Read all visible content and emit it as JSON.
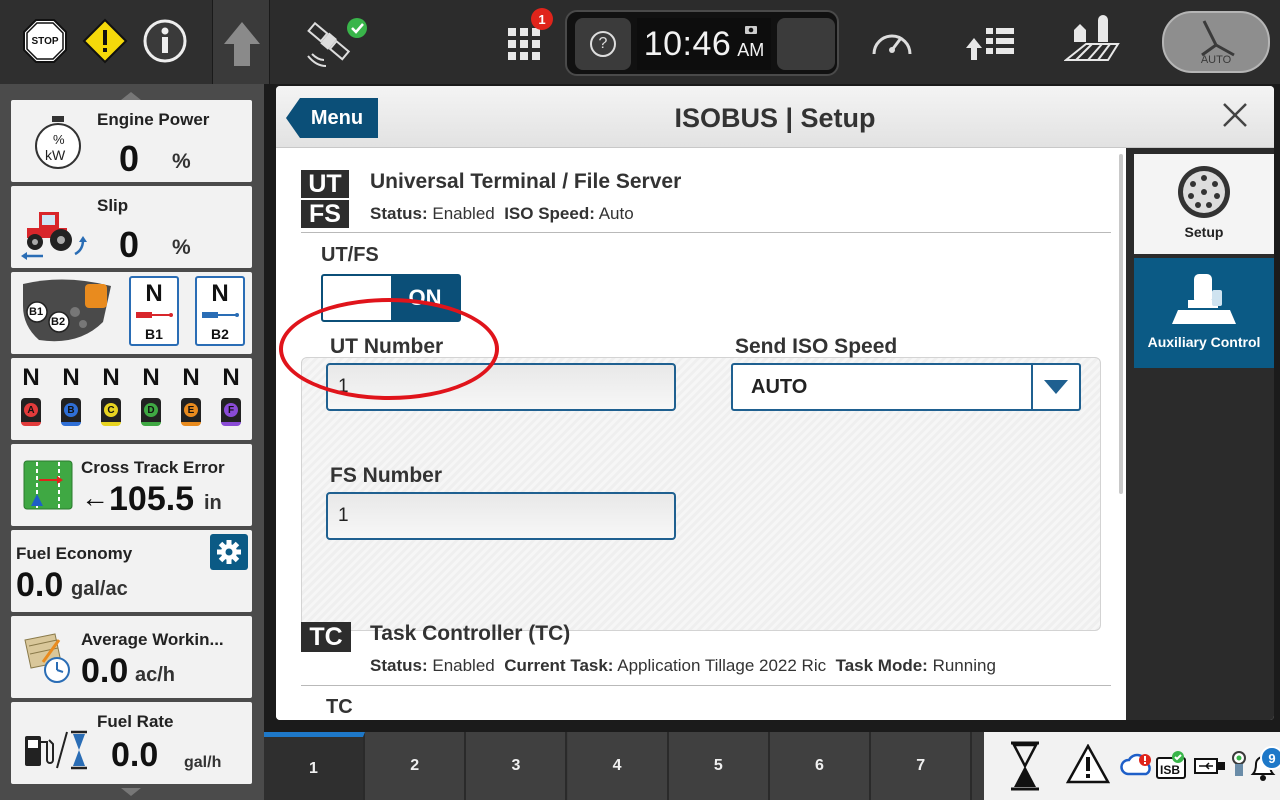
{
  "topbar": {
    "stop_label": "STOP",
    "notification_count": "1",
    "clock_time": "10:46",
    "clock_ampm": "AM",
    "help_label": "?",
    "auto_label": "AUTO"
  },
  "sidebar": {
    "engine_power": {
      "title": "Engine Power",
      "icon_text_top": "%",
      "icon_text_bottom": "kW",
      "value": "0",
      "unit": "%"
    },
    "slip": {
      "title": "Slip",
      "value": "0",
      "unit": "%"
    },
    "remotes": {
      "b1": {
        "state": "N",
        "label": "B1"
      },
      "b2": {
        "state": "N",
        "label": "B2"
      },
      "chip_b1": "B1",
      "chip_b2": "B2"
    },
    "scvs": [
      {
        "state": "N",
        "label": "A",
        "color": "#e23b3b"
      },
      {
        "state": "N",
        "label": "B",
        "color": "#2f6fd6"
      },
      {
        "state": "N",
        "label": "C",
        "color": "#e8d421"
      },
      {
        "state": "N",
        "label": "D",
        "color": "#3fa843"
      },
      {
        "state": "N",
        "label": "E",
        "color": "#e98b1e"
      },
      {
        "state": "N",
        "label": "F",
        "color": "#8a4bd6"
      }
    ],
    "cross_track": {
      "title": "Cross Track Error",
      "arrow": "←",
      "value": "105.5",
      "unit": "in"
    },
    "fuel_economy": {
      "title": "Fuel Economy",
      "value": "0.0",
      "unit": "gal/ac"
    },
    "avg_working": {
      "title": "Average Workin...",
      "value": "0.0",
      "unit": "ac/h"
    },
    "fuel_rate": {
      "title": "Fuel Rate",
      "value": "0.0",
      "unit": "gal/h"
    }
  },
  "panel": {
    "menu_label": "Menu",
    "title": "ISOBUS | Setup",
    "ut_fs": {
      "badge_top": "UT",
      "badge_bottom": "FS",
      "title": "Universal Terminal / File Server",
      "status_label": "Status:",
      "status_value": "Enabled",
      "speed_label": "ISO Speed:",
      "speed_value": "Auto",
      "toggle_label": "UT/FS",
      "toggle_state": "ON",
      "ut_number_label": "UT Number",
      "ut_number_value": "1",
      "send_iso_speed_label": "Send ISO Speed",
      "send_iso_speed_value": "AUTO",
      "fs_number_label": "FS Number",
      "fs_number_value": "1"
    },
    "tc": {
      "badge": "TC",
      "title": "Task Controller (TC)",
      "status_label": "Status:",
      "status_value": "Enabled",
      "task_label": "Current Task:",
      "task_value": "Application Tillage 2022 Ric",
      "mode_label": "Task Mode:",
      "mode_value": "Running",
      "next_partial": "TC"
    },
    "rightnav": [
      {
        "label": "Setup",
        "active": false
      },
      {
        "label": "Auxiliary Control",
        "active": true
      }
    ]
  },
  "bottombar": {
    "tabs": [
      "1",
      "2",
      "3",
      "4",
      "5",
      "6",
      "7"
    ],
    "active_tab": "1",
    "isb_label": "ISB",
    "alerts_count": "9"
  },
  "colors": {
    "accent_blue": "#0b4f78",
    "highlight_red": "#e0141b",
    "active_nav": "#0b5a85"
  }
}
